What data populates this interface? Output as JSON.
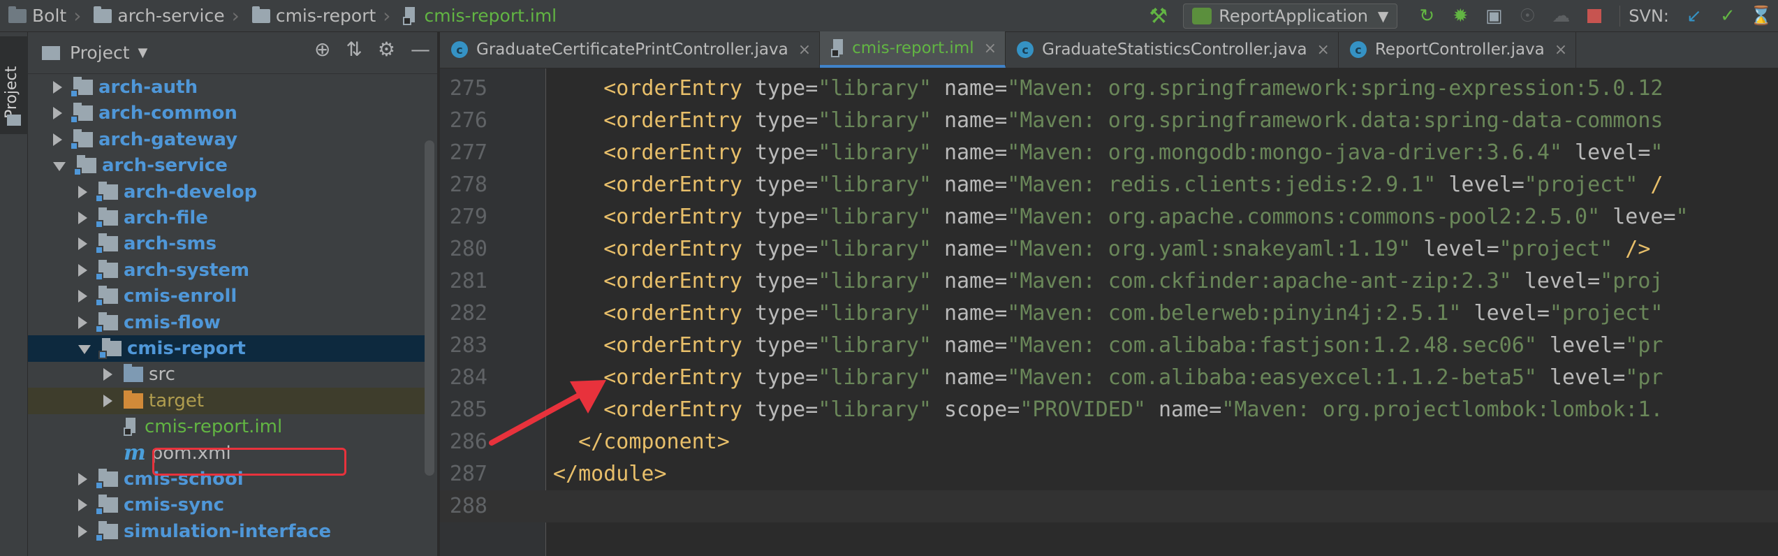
{
  "breadcrumbs": [
    {
      "label": "Bolt",
      "icon": "folder-icon"
    },
    {
      "label": "arch-service",
      "icon": "folder-icon"
    },
    {
      "label": "cmis-report",
      "icon": "folder-icon"
    },
    {
      "label": "cmis-report.iml",
      "icon": "iml-file-icon"
    }
  ],
  "toolbar": {
    "run_config": "ReportApplication",
    "svn_label": "SVN:"
  },
  "left_strip": {
    "project_tab": "Project"
  },
  "project_panel": {
    "title": "Project",
    "tree": [
      {
        "label": "arch-auth",
        "depth": 1,
        "arrow": "right",
        "kind": "module"
      },
      {
        "label": "arch-common",
        "depth": 1,
        "arrow": "right",
        "kind": "module"
      },
      {
        "label": "arch-gateway",
        "depth": 1,
        "arrow": "right",
        "kind": "module"
      },
      {
        "label": "arch-service",
        "depth": 1,
        "arrow": "down",
        "kind": "module"
      },
      {
        "label": "arch-develop",
        "depth": 2,
        "arrow": "right",
        "kind": "module"
      },
      {
        "label": "arch-file",
        "depth": 2,
        "arrow": "right",
        "kind": "module"
      },
      {
        "label": "arch-sms",
        "depth": 2,
        "arrow": "right",
        "kind": "module"
      },
      {
        "label": "arch-system",
        "depth": 2,
        "arrow": "right",
        "kind": "module"
      },
      {
        "label": "cmis-enroll",
        "depth": 2,
        "arrow": "right",
        "kind": "module"
      },
      {
        "label": "cmis-flow",
        "depth": 2,
        "arrow": "right",
        "kind": "module"
      },
      {
        "label": "cmis-report",
        "depth": 2,
        "arrow": "down",
        "kind": "module",
        "selected": true
      },
      {
        "label": "src",
        "depth": 3,
        "arrow": "right",
        "kind": "src"
      },
      {
        "label": "target",
        "depth": 3,
        "arrow": "right",
        "kind": "target"
      },
      {
        "label": "cmis-report.iml",
        "depth": 3,
        "arrow": "none",
        "kind": "iml"
      },
      {
        "label": "pom.xml",
        "depth": 3,
        "arrow": "none",
        "kind": "pom"
      },
      {
        "label": "cmis-school",
        "depth": 2,
        "arrow": "right",
        "kind": "module"
      },
      {
        "label": "cmis-sync",
        "depth": 2,
        "arrow": "right",
        "kind": "module"
      },
      {
        "label": "simulation-interface",
        "depth": 2,
        "arrow": "right",
        "kind": "module"
      }
    ]
  },
  "tabs": [
    {
      "label": "GraduateCertificatePrintController.java",
      "icon": "class-icon",
      "active": false,
      "closable": true
    },
    {
      "label": "cmis-report.iml",
      "icon": "iml-file-icon",
      "active": true,
      "closable": true
    },
    {
      "label": "GraduateStatisticsController.java",
      "icon": "class-icon",
      "active": false,
      "closable": true
    },
    {
      "label": "ReportController.java",
      "icon": "class-icon",
      "active": false,
      "closable": true
    }
  ],
  "editor": {
    "lines": [
      {
        "n": "275",
        "indent": "    ",
        "tag": "<orderEntry",
        "attrs": [
          [
            "type",
            "library"
          ],
          [
            "name",
            "Maven: org.springframework:spring-expression:5.0.12"
          ]
        ],
        "tail": ""
      },
      {
        "n": "276",
        "indent": "    ",
        "tag": "<orderEntry",
        "attrs": [
          [
            "type",
            "library"
          ],
          [
            "name",
            "Maven: org.springframework.data:spring-data-commons"
          ]
        ],
        "tail": ""
      },
      {
        "n": "277",
        "indent": "    ",
        "tag": "<orderEntry",
        "attrs": [
          [
            "type",
            "library"
          ],
          [
            "name",
            "Maven: org.mongodb:mongo-java-driver:3.6.4"
          ],
          [
            "level",
            ""
          ]
        ],
        "tail": ""
      },
      {
        "n": "278",
        "indent": "    ",
        "tag": "<orderEntry",
        "attrs": [
          [
            "type",
            "library"
          ],
          [
            "name",
            "Maven: redis.clients:jedis:2.9.1"
          ],
          [
            "level",
            "project"
          ]
        ],
        "tail": " /"
      },
      {
        "n": "279",
        "indent": "    ",
        "tag": "<orderEntry",
        "attrs": [
          [
            "type",
            "library"
          ],
          [
            "name",
            "Maven: org.apache.commons:commons-pool2:2.5.0"
          ],
          [
            "leve",
            ""
          ]
        ],
        "tail": ""
      },
      {
        "n": "280",
        "indent": "    ",
        "tag": "<orderEntry",
        "attrs": [
          [
            "type",
            "library"
          ],
          [
            "name",
            "Maven: org.yaml:snakeyaml:1.19"
          ],
          [
            "level",
            "project"
          ]
        ],
        "tail": " />"
      },
      {
        "n": "281",
        "indent": "    ",
        "tag": "<orderEntry",
        "attrs": [
          [
            "type",
            "library"
          ],
          [
            "name",
            "Maven: com.ckfinder:apache-ant-zip:2.3"
          ],
          [
            "level",
            "proj"
          ]
        ],
        "tail": ""
      },
      {
        "n": "282",
        "indent": "    ",
        "tag": "<orderEntry",
        "attrs": [
          [
            "type",
            "library"
          ],
          [
            "name",
            "Maven: com.belerweb:pinyin4j:2.5.1"
          ],
          [
            "level",
            "project"
          ]
        ],
        "tail": ""
      },
      {
        "n": "283",
        "indent": "    ",
        "tag": "<orderEntry",
        "attrs": [
          [
            "type",
            "library"
          ],
          [
            "name",
            "Maven: com.alibaba:fastjson:1.2.48.sec06"
          ],
          [
            "level",
            "pr"
          ]
        ],
        "tail": ""
      },
      {
        "n": "284",
        "indent": "    ",
        "tag": "<orderEntry",
        "attrs": [
          [
            "type",
            "library"
          ],
          [
            "name",
            "Maven: com.alibaba:easyexcel:1.1.2-beta5"
          ],
          [
            "level",
            "pr"
          ]
        ],
        "tail": ""
      },
      {
        "n": "285",
        "indent": "    ",
        "tag": "<orderEntry",
        "attrs": [
          [
            "type",
            "library"
          ],
          [
            "scope",
            "PROVIDED"
          ],
          [
            "name",
            "Maven: org.projectlombok:lombok:1."
          ]
        ],
        "tail": ""
      },
      {
        "n": "286",
        "indent": "  ",
        "tag": "</component>",
        "attrs": [],
        "tail": ""
      },
      {
        "n": "287",
        "indent": "",
        "tag": "</module>",
        "attrs": [],
        "tail": ""
      },
      {
        "n": "288",
        "indent": "",
        "tag": "",
        "attrs": [],
        "tail": "",
        "current": true
      }
    ]
  },
  "colors": {
    "annotation_red": "#e8323c",
    "tag_yellow": "#e8bf6a",
    "string_green": "#6a8759",
    "module_blue": "#4f97d8",
    "vcs_green": "#62b543"
  }
}
